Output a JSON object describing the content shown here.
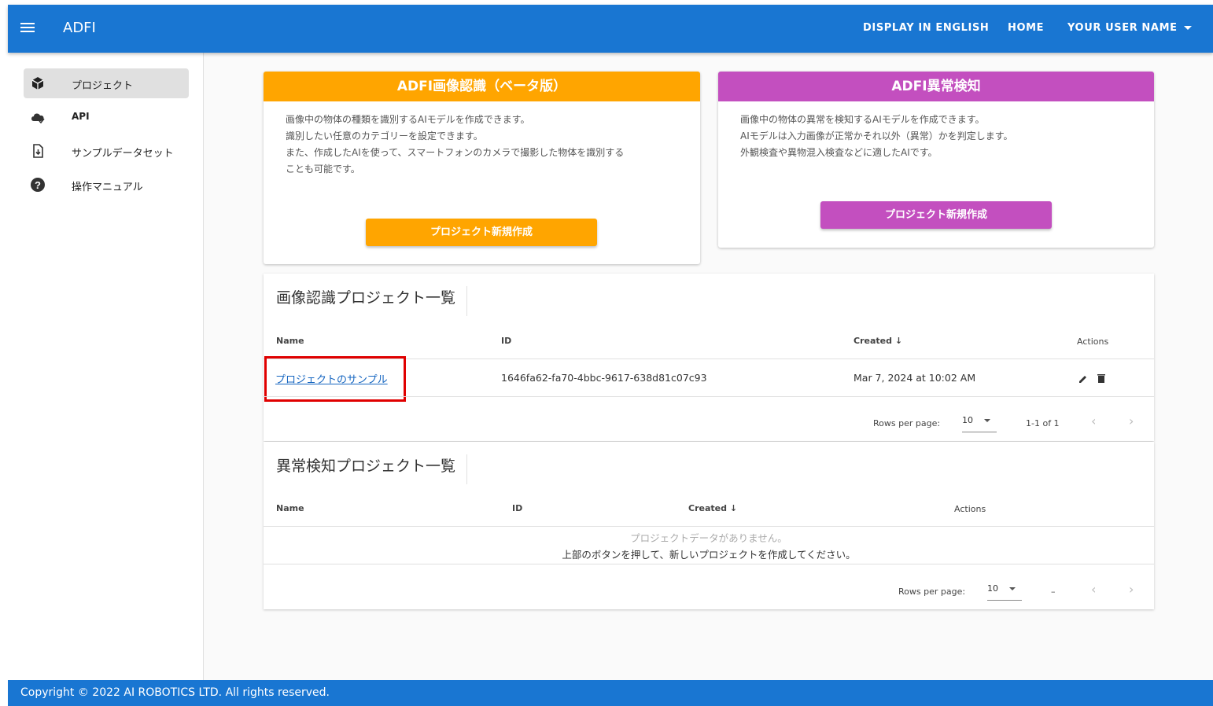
{
  "colors": {
    "primary": "#1976d2",
    "orange": "#ffa500",
    "purple": "#c34fbf",
    "highlight": "#e00000"
  },
  "appbar": {
    "title": "ADFI",
    "display_english": "DISPLAY IN ENGLISH",
    "home": "HOME",
    "user": "YOUR USER NAME"
  },
  "sidebar": {
    "items": [
      {
        "label": "プロジェクト",
        "icon": "cube-icon"
      },
      {
        "label": "API",
        "icon": "cloud-check-icon"
      },
      {
        "label": "サンプルデータセット",
        "icon": "file-download-icon"
      },
      {
        "label": "操作マニュアル",
        "icon": "help-circle-icon"
      }
    ]
  },
  "cards": {
    "recognition": {
      "title": "ADFI画像認識（ベータ版）",
      "desc": "画像中の物体の種類を識別するAIモデルを作成できます。\n識別したい任意のカテゴリーを設定できます。\nまた、作成したAIを使って、スマートフォンのカメラで撮影した物体を識別する\nことも可能です。",
      "button": "プロジェクト新規作成"
    },
    "anomaly": {
      "title": "ADFI異常検知",
      "desc": "画像中の物体の異常を検知するAIモデルを作成できます。\nAIモデルは入力画像が正常かそれ以外（異常）かを判定します。\n外観検査や異物混入検査などに適したAIです。",
      "button": "プロジェクト新規作成"
    }
  },
  "recognition_table": {
    "title": "画像認識プロジェクト一覧",
    "headers": {
      "name": "Name",
      "id": "ID",
      "created": "Created",
      "actions": "Actions"
    },
    "rows": [
      {
        "name": "プロジェクトのサンプル",
        "id": "1646fa62-fa70-4bbc-9617-638d81c07c93",
        "created": "Mar 7, 2024 at 10:02 AM"
      }
    ],
    "rows_per_page_label": "Rows per page:",
    "rows_per_page": "10",
    "range": "1-1 of 1"
  },
  "anomaly_table": {
    "title": "異常検知プロジェクト一覧",
    "headers": {
      "name": "Name",
      "id": "ID",
      "created": "Created",
      "actions": "Actions"
    },
    "empty_line1": "プロジェクトデータがありません。",
    "empty_line2": "上部のボタンを押して、新しいプロジェクトを作成してください。",
    "rows_per_page_label": "Rows per page:",
    "rows_per_page": "10",
    "range": "–"
  },
  "footer": {
    "copyright": "Copyright © 2022 AI ROBOTICS LTD. All rights reserved."
  }
}
